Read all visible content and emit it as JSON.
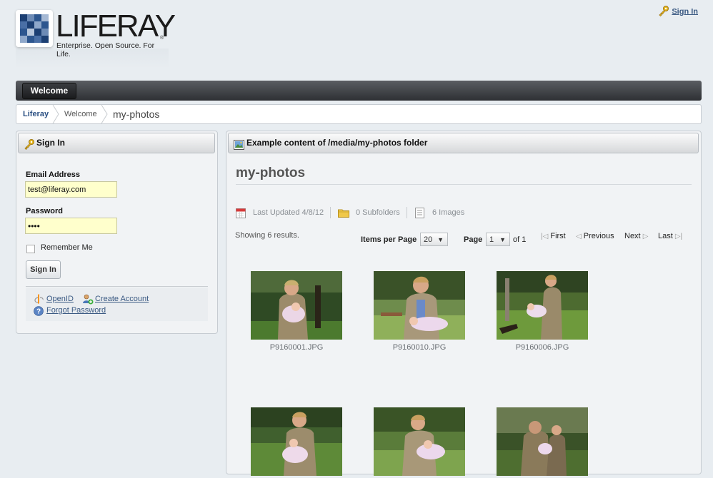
{
  "header": {
    "logo_word": "LIFERAY",
    "logo_reg": "®",
    "logo_tagline": "Enterprise. Open Source. For Life.",
    "top_signin_label": "Sign In"
  },
  "nav": {
    "tabs": [
      {
        "label": "Welcome"
      }
    ]
  },
  "breadcrumb": [
    {
      "label": "Liferay"
    },
    {
      "label": "Welcome"
    },
    {
      "label": "my-photos"
    }
  ],
  "signin_portlet": {
    "title": "Sign In",
    "email_label": "Email Address",
    "email_value": "test@liferay.com",
    "password_label": "Password",
    "password_value": "••••",
    "remember_label": "Remember Me",
    "submit_label": "Sign In",
    "links": {
      "openid": "OpenID",
      "create_account": "Create Account",
      "forgot_password": "Forgot Password"
    }
  },
  "content_portlet": {
    "title": "Example content of /media/my-photos folder",
    "folder_title": "my-photos",
    "last_updated": "Last Updated 4/8/12",
    "subfolders": "0 Subfolders",
    "images": "6 Images",
    "showing": "Showing 6 results.",
    "items_per_page_label": "Items per Page",
    "items_per_page_value": "20",
    "page_label": "Page",
    "page_value": "1",
    "page_of": "of 1",
    "pager": {
      "first": "First",
      "previous": "Previous",
      "next": "Next",
      "last": "Last"
    },
    "photos": [
      {
        "name": "P9160001.JPG"
      },
      {
        "name": "P9160010.JPG"
      },
      {
        "name": "P9160006.JPG"
      },
      {
        "name": ""
      },
      {
        "name": ""
      },
      {
        "name": ""
      }
    ]
  },
  "colors": {
    "nav_bg": "#3a3c40",
    "link": "#1f4e96",
    "input_bg": "#ffffcc",
    "page_bg": "#e8edf1"
  }
}
